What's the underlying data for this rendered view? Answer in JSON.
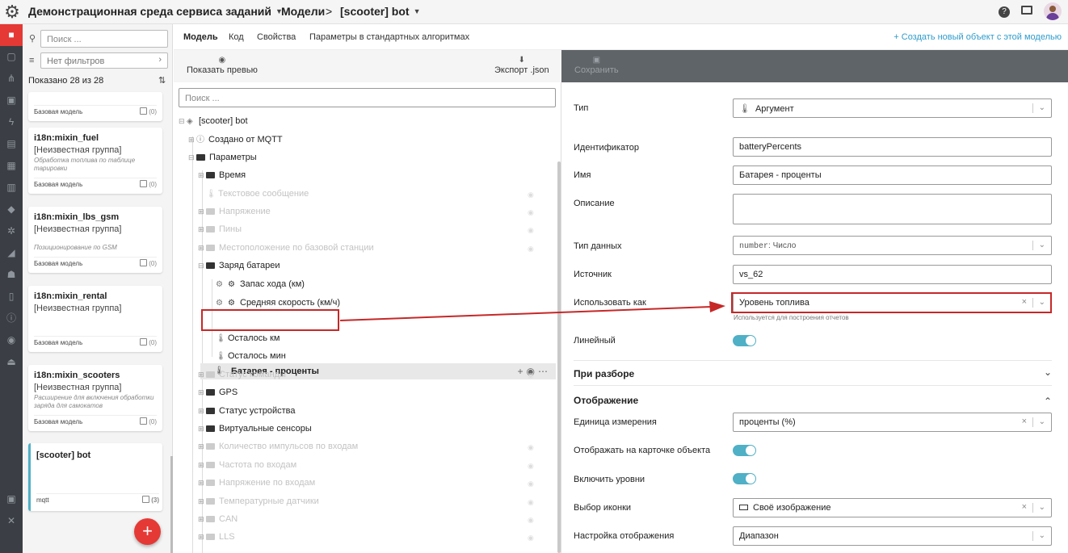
{
  "topbar": {
    "app_title": "Демонстрационная среда сервиса заданий",
    "crumb_models": "Модели",
    "crumb_sep": ">",
    "crumb_current": "[scooter] bot"
  },
  "left": {
    "search_placeholder": "Поиск ...",
    "filter_value": "Нет фильтров",
    "shown_count": "Показано 28 из 28",
    "cards": [
      {
        "title": "",
        "group": "",
        "desc": "",
        "type": "Базовая модель",
        "count": "(0)"
      },
      {
        "title": "i18n:mixin_fuel",
        "group": "[Неизвестная группа]",
        "desc": "Обработка топлива по таблице тарировки",
        "type": "Базовая модель",
        "count": "(0)"
      },
      {
        "title": "i18n:mixin_lbs_gsm",
        "group": "[Неизвестная группа]",
        "desc": "Позиционирование по GSM",
        "type": "Базовая модель",
        "count": "(0)"
      },
      {
        "title": "i18n:mixin_rental",
        "group": "[Неизвестная группа]",
        "desc": "",
        "type": "Базовая модель",
        "count": "(0)"
      },
      {
        "title": "i18n:mixin_scooters",
        "group": "[Неизвестная группа]",
        "desc": "Расширение для включения обработки заряда для самокатов",
        "type": "Базовая модель",
        "count": "(0)"
      },
      {
        "title": "[scooter] bot",
        "group": "",
        "desc": "",
        "type": "mqtt",
        "count": "(3)"
      }
    ]
  },
  "tabs": {
    "items": [
      "Модель",
      "Код",
      "Свойства",
      "Параметры в стандартных алгоритмах"
    ],
    "new_object": "+ Создать новый объект с этой моделью"
  },
  "tree": {
    "preview": "Показать превью",
    "export": "Экспорт .json",
    "search_placeholder": "Поиск ...",
    "nodes": [
      "[scooter] bot",
      "Создано от MQTT",
      "Параметры",
      "Время",
      "Текстовое сообщение",
      "Напряжение",
      "Пины",
      "Местоположение по базовой станции",
      "Заряд батареи",
      "Запас хода (км)",
      "Средняя скорость (км/ч)",
      "Батарея - проценты",
      "Осталось км",
      "Осталось мин",
      "Статус команды",
      "GPS",
      "Статус устройства",
      "Виртуальные сенсоры",
      "Количество импульсов по входам",
      "Частота по входам",
      "Напряжение по входам",
      "Температурные датчики",
      "CAN",
      "LLS"
    ]
  },
  "form": {
    "save": "Сохранить",
    "labels": {
      "type": "Тип",
      "identifier": "Идентификатор",
      "name": "Имя",
      "description": "Описание",
      "data_type": "Тип данных",
      "source": "Источник",
      "use_as": "Использовать как",
      "linear": "Линейный",
      "unit": "Единица измерения",
      "show_on_card": "Отображать на карточке объекта",
      "enable_levels": "Включить уровни",
      "icon_choice": "Выбор иконки",
      "display_setting": "Настройка отображения"
    },
    "values": {
      "type": "Аргумент",
      "identifier": "batteryPercents",
      "name": "Батарея - проценты",
      "description": "",
      "data_type_code": "number",
      "data_type_label": ": Число",
      "source": "vs_62",
      "use_as": "Уровень топлива",
      "use_as_hint": "Используется для построения отчетов",
      "linear": true,
      "unit": "проценты (%)",
      "show_on_card": true,
      "enable_levels": true,
      "icon_choice": "Своё изображение",
      "display_setting": "Диапазон"
    },
    "sections": {
      "parsing": "При разборе",
      "display": "Отображение"
    }
  },
  "colors": {
    "accent_red": "#e53935",
    "toggle_on": "#4fb0c6",
    "link": "#2e9ccb",
    "highlight_box": "#c62828"
  }
}
